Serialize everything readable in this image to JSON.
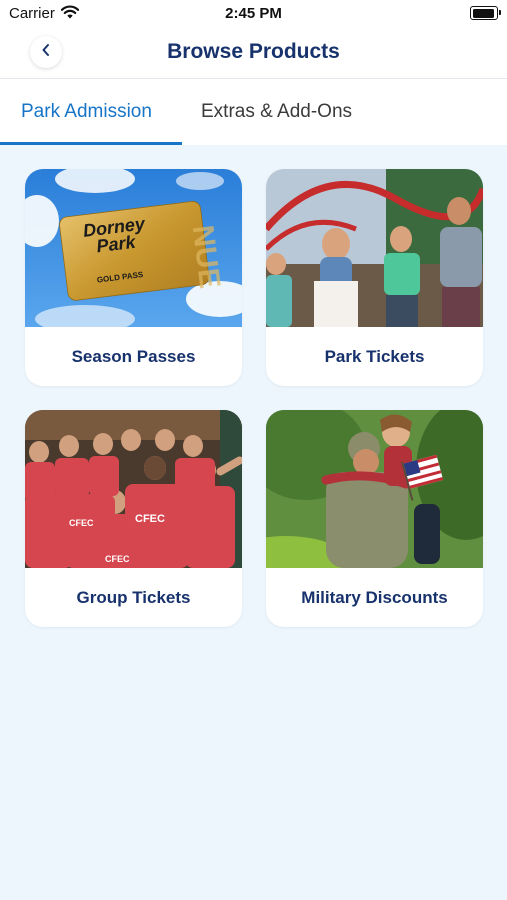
{
  "status_bar": {
    "carrier": "Carrier",
    "time": "2:45 PM"
  },
  "nav": {
    "title": "Browse Products"
  },
  "tabs": [
    {
      "label": "Park Admission",
      "active": true
    },
    {
      "label": "Extras & Add-Ons",
      "active": false
    }
  ],
  "products": [
    {
      "label": "Season Passes",
      "card_brand_line1": "Dorney",
      "card_brand_line2": "Park",
      "card_tier": "GOLD PASS"
    },
    {
      "label": "Park Tickets"
    },
    {
      "label": "Group Tickets",
      "shirt_text": "CFEC"
    },
    {
      "label": "Military Discounts"
    }
  ],
  "colors": {
    "accent": "#1774c7",
    "title": "#17326c",
    "background": "#ecf6fc"
  }
}
